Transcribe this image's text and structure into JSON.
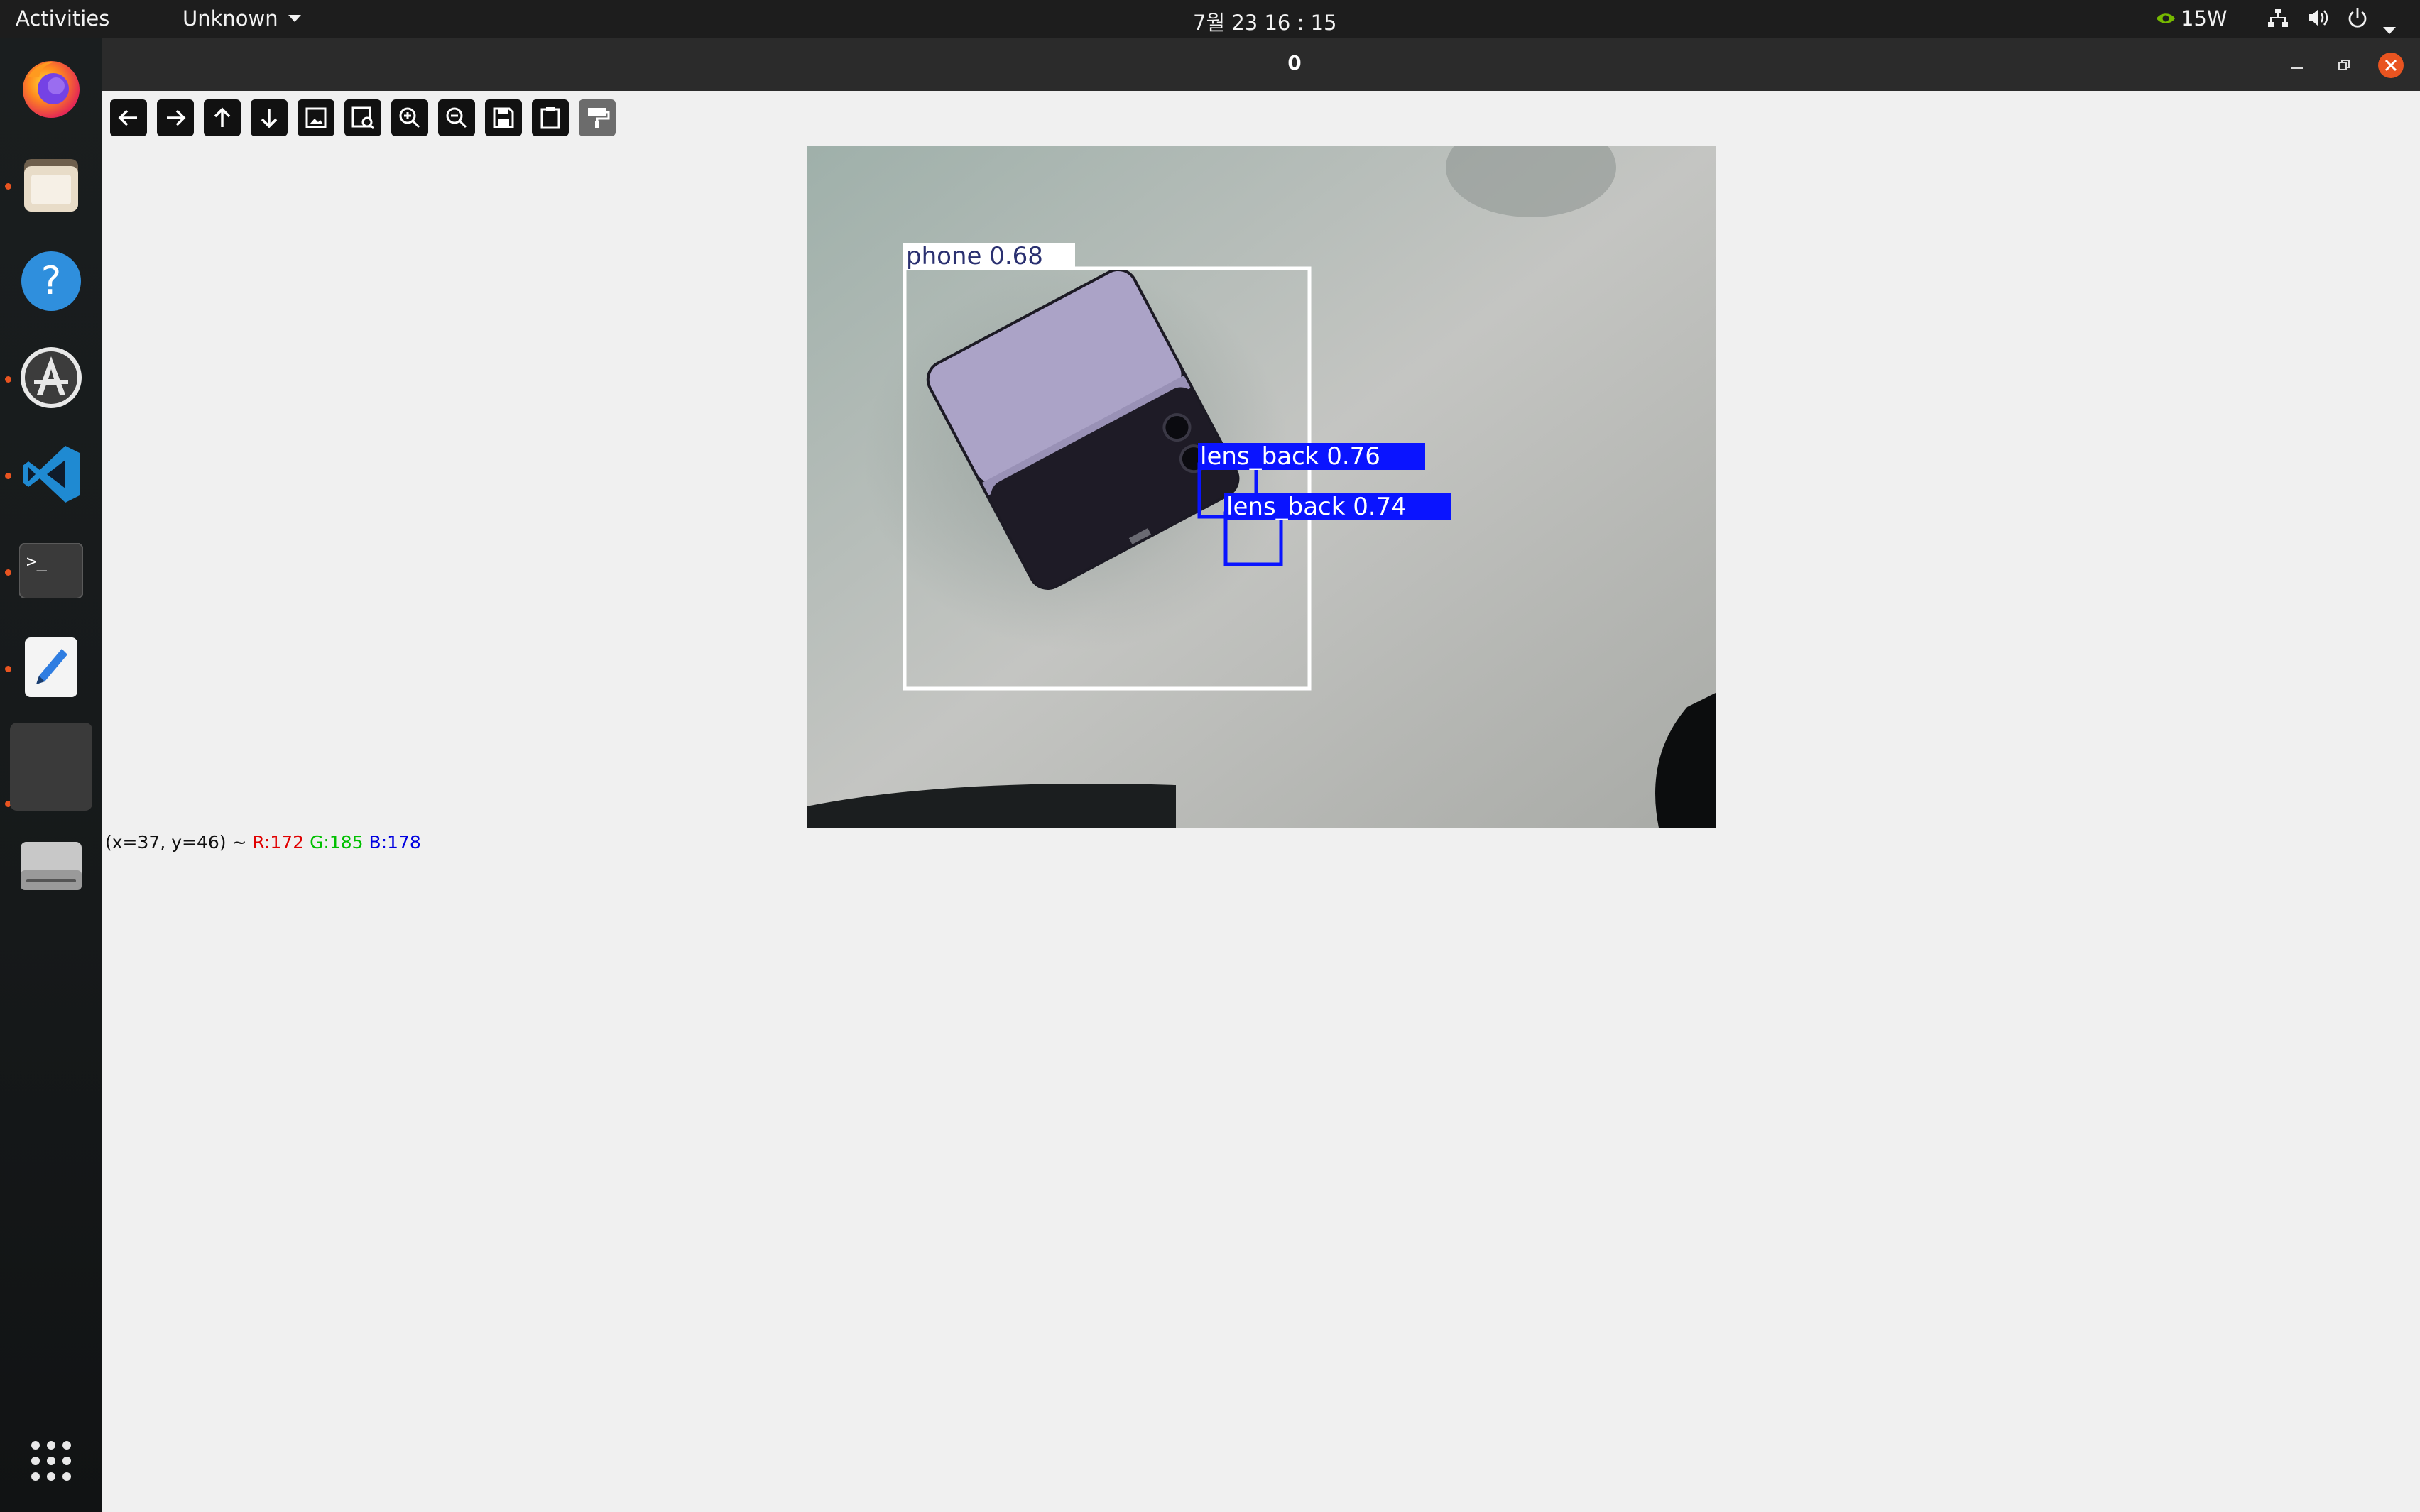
{
  "topbar": {
    "activities": "Activities",
    "app_menu": "Unknown",
    "clock": "7월 23  16 : 15",
    "power_mode": "15W",
    "icons": [
      "nvidia-icon",
      "network-icon",
      "volume-icon",
      "power-icon",
      "caret-down-icon"
    ]
  },
  "dock": {
    "items": [
      {
        "name": "firefox",
        "running": false
      },
      {
        "name": "files",
        "running": true
      },
      {
        "name": "help",
        "running": false
      },
      {
        "name": "software-center",
        "running": true
      },
      {
        "name": "vscode",
        "running": true
      },
      {
        "name": "terminal",
        "running": true
      },
      {
        "name": "text-editor",
        "running": true
      },
      {
        "name": "image-viewer-window",
        "running": true,
        "active": true
      },
      {
        "name": "drive",
        "running": false
      },
      {
        "name": "show-apps",
        "running": false
      }
    ]
  },
  "window": {
    "title": "0",
    "controls": [
      "minimize",
      "restore",
      "close"
    ],
    "close_color": "#e95420"
  },
  "toolbar": {
    "buttons": [
      {
        "name": "pan-left",
        "enabled": true
      },
      {
        "name": "pan-right",
        "enabled": true
      },
      {
        "name": "pan-up",
        "enabled": true
      },
      {
        "name": "pan-down",
        "enabled": true
      },
      {
        "name": "zoom-fit",
        "enabled": true
      },
      {
        "name": "zoom-original",
        "enabled": true
      },
      {
        "name": "zoom-in",
        "enabled": true
      },
      {
        "name": "zoom-out",
        "enabled": true
      },
      {
        "name": "save",
        "enabled": true
      },
      {
        "name": "copy-clipboard",
        "enabled": true
      },
      {
        "name": "properties",
        "enabled": false
      }
    ]
  },
  "detections": [
    {
      "label": "phone 0.68",
      "color": "#ffffff",
      "text_color": "#2a3070"
    },
    {
      "label": "lens_back 0.76",
      "color": "#0a14ff",
      "text_color": "#ffffff"
    },
    {
      "label": "lens_back 0.74",
      "color": "#0a14ff",
      "text_color": "#ffffff"
    }
  ],
  "status": {
    "coords": "(x=37, y=46) ~",
    "r": "R:172",
    "g": "G:185",
    "b": "B:178",
    "r_color": "#e00000",
    "g_color": "#00c000",
    "b_color": "#0000e0"
  }
}
